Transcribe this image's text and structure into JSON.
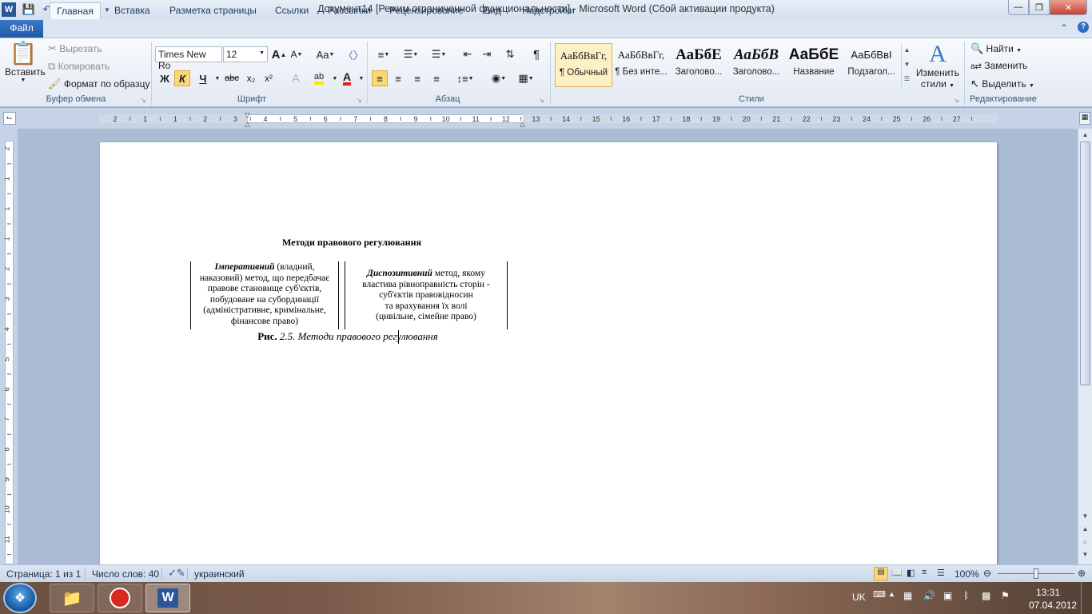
{
  "window": {
    "title": "Документ14 [Режим ограниченной функциональности]  -  Microsoft Word (Сбой активации продукта)"
  },
  "tabs": [
    {
      "label": "Файл"
    },
    {
      "label": "Главная"
    },
    {
      "label": "Вставка"
    },
    {
      "label": "Разметка страницы"
    },
    {
      "label": "Ссылки"
    },
    {
      "label": "Рассылки"
    },
    {
      "label": "Рецензирование"
    },
    {
      "label": "Вид"
    },
    {
      "label": "Надстройки"
    }
  ],
  "clipboard": {
    "paste": "Вставить",
    "cut": "Вырезать",
    "copy": "Копировать",
    "format_painter": "Формат по образцу",
    "label": "Буфер обмена"
  },
  "font": {
    "family": "Times New Ro",
    "size": "12",
    "bold": "Ж",
    "italic": "К",
    "underline": "Ч",
    "strike": "abc",
    "sub": "x₂",
    "sup": "x²",
    "grow": "A",
    "shrink": "A",
    "case": "Aa",
    "label": "Шрифт"
  },
  "paragraph": {
    "label": "Абзац",
    "pilcrow": "¶"
  },
  "styles": {
    "label": "Стили",
    "items": [
      {
        "sample": "АаБбВвГг,",
        "name": "¶ Обычный"
      },
      {
        "sample": "АаБбВвГг,",
        "name": "¶ Без инте..."
      },
      {
        "sample": "АаБбЕ",
        "name": "Заголово..."
      },
      {
        "sample": "АаБбВ",
        "name": "Заголово..."
      },
      {
        "sample": "АаБбЕ",
        "name": "Название"
      },
      {
        "sample": "АаБбВвІ",
        "name": "Подзагол..."
      }
    ],
    "change_line1": "Изменить",
    "change_line2": "стили"
  },
  "editing": {
    "label": "Редактирование",
    "find": "Найти",
    "replace": "Заменить",
    "select": "Выделить"
  },
  "ruler": {
    "h_ticks": [
      "2",
      "1",
      "1",
      "2",
      "3",
      "4",
      "5",
      "6",
      "7",
      "8",
      "9",
      "10",
      "11",
      "12",
      "13",
      "14",
      "15",
      "16",
      "17",
      "18",
      "19",
      "20",
      "21",
      "22",
      "23",
      "24",
      "25",
      "26",
      "27"
    ],
    "v_ticks": [
      "2",
      "1",
      "1",
      "1",
      "2",
      "3",
      "4",
      "5",
      "6",
      "7",
      "8",
      "9",
      "10",
      "11"
    ]
  },
  "document": {
    "heading": "Методи правового регулювання",
    "left_box": {
      "term": "Імперативний",
      "line1_rest": " (владний,",
      "line2": "наказовий) метод, що передбачає",
      "line3": "правове становище суб'єктів,",
      "line4": "побудоване на субординації",
      "line5": "(адміністративне,  кримінальне,",
      "line6": "фінансове право)"
    },
    "right_box": {
      "term": "Диспозитивний",
      "line1_rest": " метод, якому",
      "line2": "властива рівноправність сторін -",
      "line3": "суб'єктів правовідносин",
      "line4": "та врахування їх волі",
      "line5": "(цивільне, сімейне право)"
    },
    "caption_label": "Рис.",
    "caption_text": " 2.5. Методи правового регулювання"
  },
  "status": {
    "page": "Страница: 1 из 1",
    "words": "Число слов: 40",
    "language": "украинский",
    "zoom": "100%"
  },
  "taskbar": {
    "lang": "UK",
    "time": "13:31",
    "date": "07.04.2012"
  }
}
